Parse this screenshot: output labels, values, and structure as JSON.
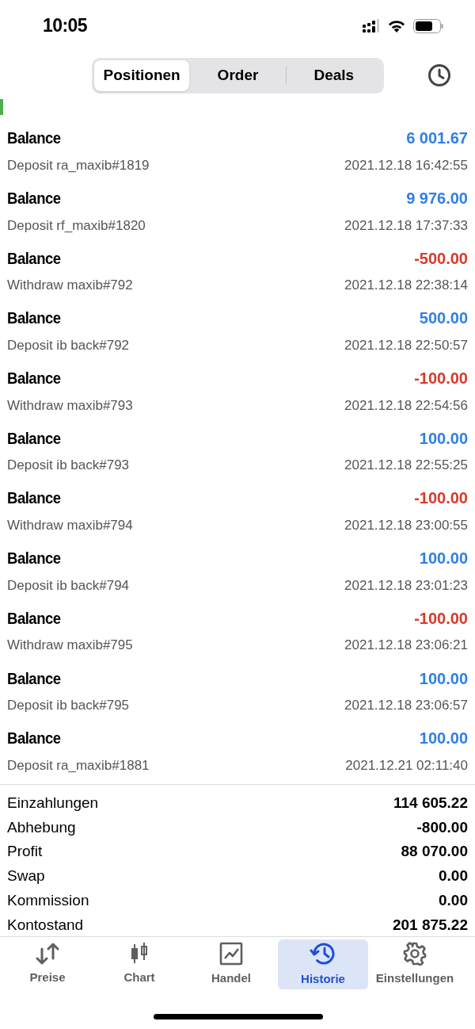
{
  "status_bar": {
    "time": "10:05"
  },
  "segments": [
    {
      "label": "Positionen",
      "selected": true
    },
    {
      "label": "Order",
      "selected": false
    },
    {
      "label": "Deals",
      "selected": false
    }
  ],
  "deals": [
    {
      "title": "Balance",
      "comment": "Deposit ra_maxib#1819",
      "amount": "6 001.67",
      "kind": "credit",
      "time": "2021.12.18 16:42:55"
    },
    {
      "title": "Balance",
      "comment": "Deposit rf_maxib#1820",
      "amount": "9 976.00",
      "kind": "credit",
      "time": "2021.12.18 17:37:33"
    },
    {
      "title": "Balance",
      "comment": "Withdraw maxib#792",
      "amount": "-500.00",
      "kind": "debit",
      "time": "2021.12.18 22:38:14"
    },
    {
      "title": "Balance",
      "comment": "Deposit ib back#792",
      "amount": "500.00",
      "kind": "credit",
      "time": "2021.12.18 22:50:57"
    },
    {
      "title": "Balance",
      "comment": "Withdraw maxib#793",
      "amount": "-100.00",
      "kind": "debit",
      "time": "2021.12.18 22:54:56"
    },
    {
      "title": "Balance",
      "comment": "Deposit ib back#793",
      "amount": "100.00",
      "kind": "credit",
      "time": "2021.12.18 22:55:25"
    },
    {
      "title": "Balance",
      "comment": "Withdraw maxib#794",
      "amount": "-100.00",
      "kind": "debit",
      "time": "2021.12.18 23:00:55"
    },
    {
      "title": "Balance",
      "comment": "Deposit ib back#794",
      "amount": "100.00",
      "kind": "credit",
      "time": "2021.12.18 23:01:23"
    },
    {
      "title": "Balance",
      "comment": "Withdraw maxib#795",
      "amount": "-100.00",
      "kind": "debit",
      "time": "2021.12.18 23:06:21"
    },
    {
      "title": "Balance",
      "comment": "Deposit ib back#795",
      "amount": "100.00",
      "kind": "credit",
      "time": "2021.12.18 23:06:57"
    },
    {
      "title": "Balance",
      "comment": "Deposit ra_maxib#1881",
      "amount": "100.00",
      "kind": "credit",
      "time": "2021.12.21 02:11:40"
    }
  ],
  "summary": [
    {
      "label": "Einzahlungen",
      "value": "114 605.22"
    },
    {
      "label": "Abhebung",
      "value": "-800.00"
    },
    {
      "label": "Profit",
      "value": "88 070.00"
    },
    {
      "label": "Swap",
      "value": "0.00"
    },
    {
      "label": "Kommission",
      "value": "0.00"
    },
    {
      "label": "Kontostand",
      "value": "201 875.22"
    }
  ],
  "tab_bar": [
    {
      "label": "Preise",
      "kind": "arrows",
      "selected": false
    },
    {
      "label": "Chart",
      "kind": "candles",
      "selected": false
    },
    {
      "label": "Handel",
      "kind": "trend",
      "selected": false
    },
    {
      "label": "Historie",
      "kind": "history",
      "selected": true
    },
    {
      "label": "Einstellungen",
      "kind": "gear",
      "selected": false
    }
  ]
}
